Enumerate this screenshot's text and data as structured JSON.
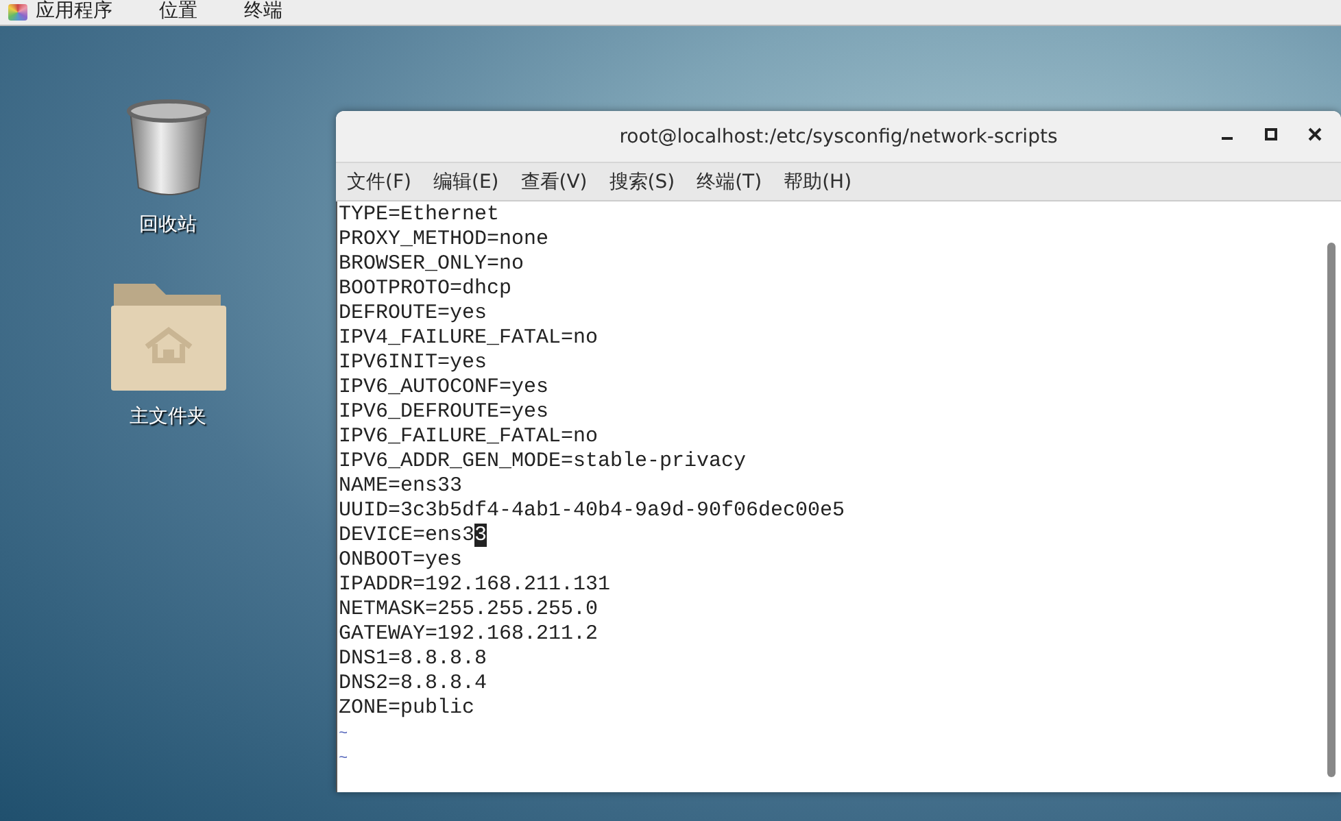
{
  "top_bar": {
    "menus": [
      "应用程序",
      "位置",
      "终端"
    ]
  },
  "desktop_icons": [
    {
      "kind": "trash",
      "label": "回收站"
    },
    {
      "kind": "home",
      "label": "主文件夹"
    }
  ],
  "window": {
    "title": "root@localhost:/etc/sysconfig/network-scripts",
    "menu": [
      "文件(F)",
      "编辑(E)",
      "查看(V)",
      "搜索(S)",
      "终端(T)",
      "帮助(H)"
    ],
    "lines": [
      {
        "kind": "text",
        "text": "TYPE=Ethernet"
      },
      {
        "kind": "text",
        "text": "PROXY_METHOD=none"
      },
      {
        "kind": "text",
        "text": "BROWSER_ONLY=no"
      },
      {
        "kind": "text",
        "text": "BOOTPROTO=dhcp"
      },
      {
        "kind": "text",
        "text": "DEFROUTE=yes"
      },
      {
        "kind": "text",
        "text": "IPV4_FAILURE_FATAL=no"
      },
      {
        "kind": "text",
        "text": "IPV6INIT=yes"
      },
      {
        "kind": "text",
        "text": "IPV6_AUTOCONF=yes"
      },
      {
        "kind": "text",
        "text": "IPV6_DEFROUTE=yes"
      },
      {
        "kind": "text",
        "text": "IPV6_FAILURE_FATAL=no"
      },
      {
        "kind": "text",
        "text": "IPV6_ADDR_GEN_MODE=stable-privacy"
      },
      {
        "kind": "text",
        "text": "NAME=ens33"
      },
      {
        "kind": "text",
        "text": "UUID=3c3b5df4-4ab1-40b4-9a9d-90f06dec00e5"
      },
      {
        "kind": "text",
        "text": "DEVICE=ens3",
        "cursor": "3"
      },
      {
        "kind": "text",
        "text": "ONBOOT=yes"
      },
      {
        "kind": "text",
        "text": "IPADDR=192.168.211.131"
      },
      {
        "kind": "text",
        "text": "NETMASK=255.255.255.0"
      },
      {
        "kind": "text",
        "text": "GATEWAY=192.168.211.2"
      },
      {
        "kind": "text",
        "text": "DNS1=8.8.8.8"
      },
      {
        "kind": "text",
        "text": "DNS2=8.8.8.4"
      },
      {
        "kind": "text",
        "text": "ZONE=public"
      },
      {
        "kind": "empty",
        "text": "~"
      },
      {
        "kind": "empty",
        "text": "~"
      }
    ]
  }
}
